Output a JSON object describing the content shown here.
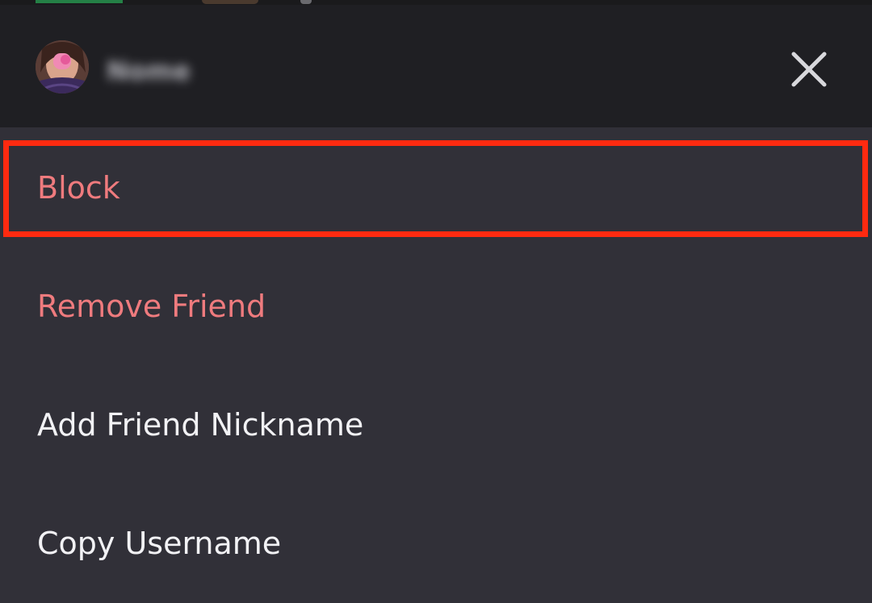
{
  "header": {
    "username": "Nome",
    "close_icon": "close-icon"
  },
  "menu": {
    "items": [
      {
        "label": "Block",
        "style": "danger",
        "highlighted": true
      },
      {
        "label": "Remove Friend",
        "style": "danger"
      },
      {
        "label": "Add Friend Nickname",
        "style": "normal"
      },
      {
        "label": "Copy Username",
        "style": "normal"
      }
    ]
  },
  "colors": {
    "sheet_background": "#313038",
    "header_background": "#1f1f23",
    "danger_text": "#ef7b7e",
    "normal_text": "#f2f2f5",
    "highlight_border": "#ff2a10"
  }
}
